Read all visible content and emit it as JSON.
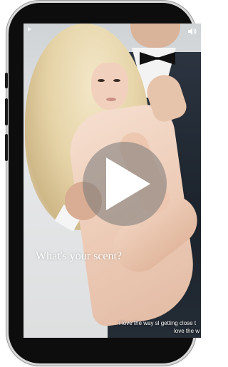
{
  "video": {
    "overlay_text": "What's your scent?",
    "caption_line1": "i love the way sl getting close t",
    "caption_line2": "love the w"
  },
  "controls": {
    "top_left_icon": "play-small-icon",
    "top_right_icon": "volume-icon",
    "center_icon": "play-icon"
  },
  "colors": {
    "device_frame": "#0d0d0d",
    "play_overlay": "#787878",
    "text": "#ffffff"
  }
}
